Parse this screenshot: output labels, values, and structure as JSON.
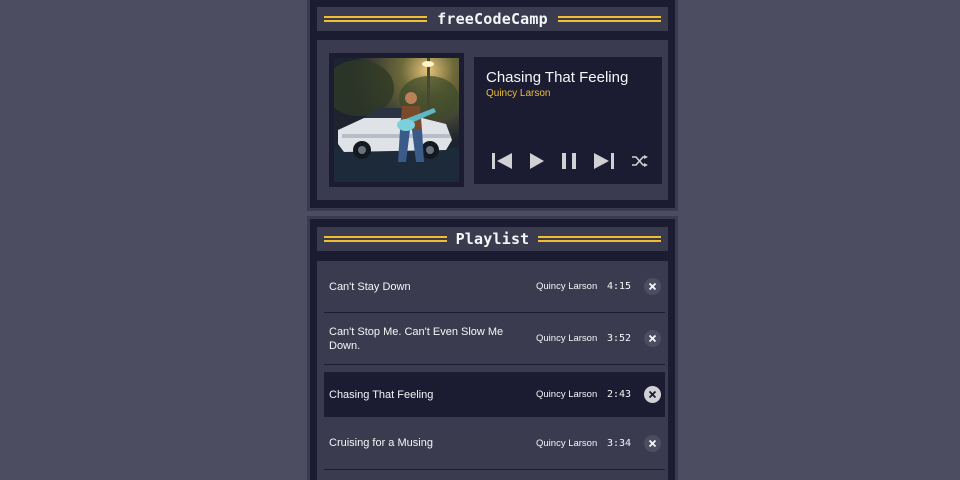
{
  "header": {
    "title": "freeCodeCamp"
  },
  "now_playing": {
    "title": "Chasing That Feeling",
    "artist": "Quincy Larson",
    "controls": [
      "previous-icon",
      "play-icon",
      "pause-icon",
      "next-icon",
      "shuffle-icon"
    ]
  },
  "playlist": {
    "title": "Playlist",
    "songs": [
      {
        "title": "Can't Stay Down",
        "artist": "Quincy Larson",
        "duration": "4:15"
      },
      {
        "title": "Can't Stop Me. Can't Even Slow Me Down.",
        "artist": "Quincy Larson",
        "duration": "3:52"
      },
      {
        "title": "Chasing That Feeling",
        "artist": "Quincy Larson",
        "duration": "2:43"
      },
      {
        "title": "Cruising for a Musing",
        "artist": "Quincy Larson",
        "duration": "3:34"
      }
    ],
    "current_index": 2
  },
  "colors": {
    "background": "#4d4d62",
    "panel": "#1b1b32",
    "panel_inner": "#3b3b4f",
    "accent": "#f1be32",
    "text": "#f5f6f7"
  }
}
